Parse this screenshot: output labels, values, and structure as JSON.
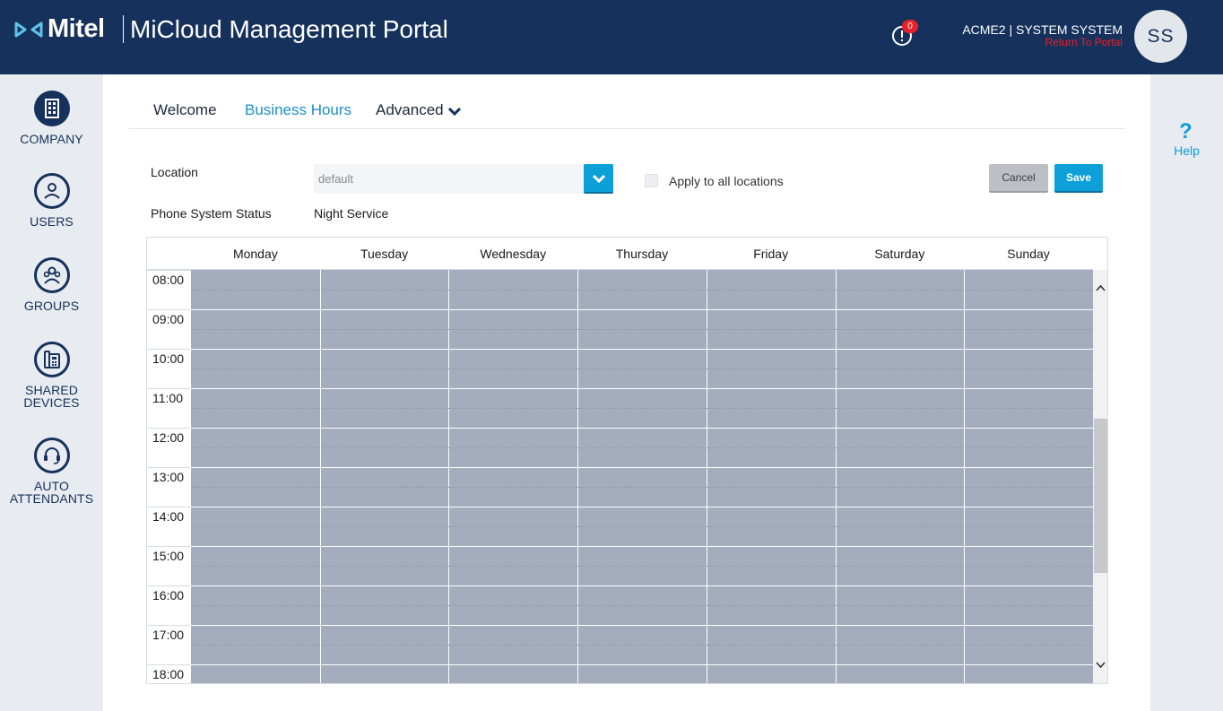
{
  "header": {
    "logo_text": "Mitel",
    "portal_title": "MiCloud Management Portal",
    "alert_count": "0",
    "user_name": "ACME2 | SYSTEM SYSTEM",
    "return_link": "Return To Portal",
    "avatar_initials": "SS",
    "background": "#15315c"
  },
  "nav": {
    "items": [
      {
        "label": "COMPANY",
        "icon": "building-icon"
      },
      {
        "label": "USERS",
        "icon": "user-icon"
      },
      {
        "label": "GROUPS",
        "icon": "group-icon"
      },
      {
        "label_line1": "SHARED",
        "label_line2": "DEVICES",
        "icon": "desk-phone-icon"
      },
      {
        "label_line1": "AUTO",
        "label_line2": "ATTENDANTS",
        "icon": "headset-icon"
      }
    ]
  },
  "help": {
    "label": "Help",
    "icon": "question-icon"
  },
  "tabs": [
    {
      "label": "Welcome",
      "active": false
    },
    {
      "label": "Business Hours",
      "active": true
    },
    {
      "label": "Advanced",
      "active": false
    }
  ],
  "form": {
    "location_label": "Location",
    "location_value": "default",
    "apply_all_label": "Apply to all locations",
    "status_label": "Phone System Status",
    "status_value": "Night Service",
    "cancel_label": "Cancel",
    "save_label": "Save"
  },
  "schedule": {
    "days": [
      "Monday",
      "Tuesday",
      "Wednesday",
      "Thursday",
      "Friday",
      "Saturday",
      "Sunday"
    ],
    "times": [
      "08:00",
      "09:00",
      "10:00",
      "11:00",
      "12:00",
      "13:00",
      "14:00",
      "15:00",
      "16:00",
      "17:00",
      "18:00"
    ],
    "slot_color": "#a3adbe"
  },
  "colors": {
    "accent": "#0d9fd8",
    "active_tab": "#1a90c8",
    "alert_red": "#e8222a"
  }
}
